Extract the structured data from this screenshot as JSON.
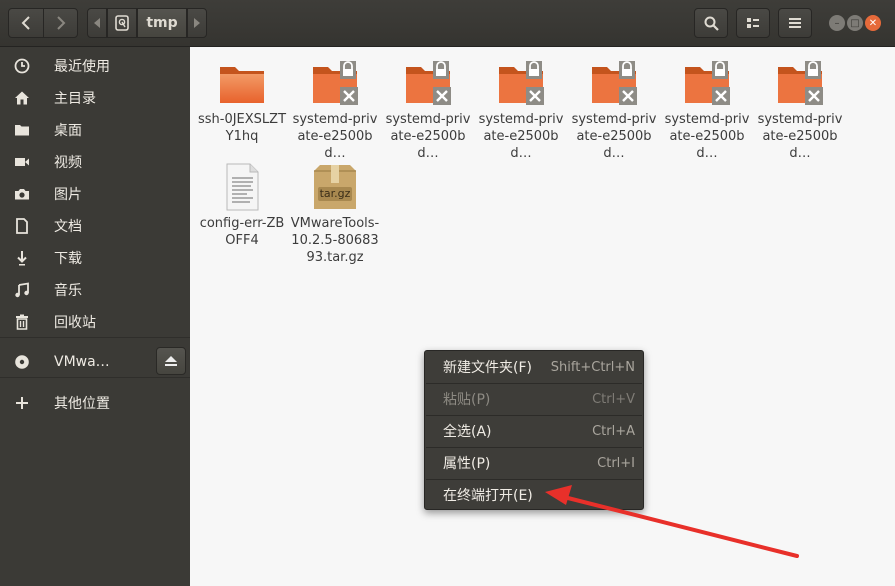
{
  "window": {
    "path": {
      "current": "tmp"
    }
  },
  "sidebar": {
    "items": [
      {
        "label": "最近使用",
        "icon": "clock-icon"
      },
      {
        "label": "主目录",
        "icon": "home-icon"
      },
      {
        "label": "桌面",
        "icon": "folder-icon"
      },
      {
        "label": "视频",
        "icon": "video-icon"
      },
      {
        "label": "图片",
        "icon": "camera-icon"
      },
      {
        "label": "文档",
        "icon": "document-icon"
      },
      {
        "label": "下载",
        "icon": "download-icon"
      },
      {
        "label": "音乐",
        "icon": "music-icon"
      },
      {
        "label": "回收站",
        "icon": "trash-icon"
      },
      {
        "label": "VMwa…",
        "icon": "disc-icon"
      },
      {
        "label": "其他位置",
        "icon": "plus-icon"
      }
    ]
  },
  "files": [
    {
      "name": "ssh-0JEXSLZTY1hq",
      "type": "folder"
    },
    {
      "name": "systemd-private-e2500bd…",
      "type": "folder-locked"
    },
    {
      "name": "systemd-private-e2500bd…",
      "type": "folder-locked"
    },
    {
      "name": "systemd-private-e2500bd…",
      "type": "folder-locked"
    },
    {
      "name": "systemd-private-e2500bd…",
      "type": "folder-locked"
    },
    {
      "name": "systemd-private-e2500bd…",
      "type": "folder-locked"
    },
    {
      "name": "systemd-private-e2500bd…",
      "type": "folder-locked"
    },
    {
      "name": "config-err-ZBOFF4",
      "type": "text-file"
    },
    {
      "name": "VMwareTools-10.2.5-8068393.tar.gz",
      "type": "archive",
      "badge": "tar.gz"
    }
  ],
  "context_menu": {
    "items": [
      {
        "label": "新建文件夹(F)",
        "accel": "Shift+Ctrl+N",
        "enabled": true
      },
      {
        "label": "粘贴(P)",
        "accel": "Ctrl+V",
        "enabled": false
      },
      {
        "label": "全选(A)",
        "accel": "Ctrl+A",
        "enabled": true
      },
      {
        "label": "属性(P)",
        "accel": "Ctrl+I",
        "enabled": true
      },
      {
        "label": "在终端打开(E)",
        "accel": "",
        "enabled": true
      }
    ]
  },
  "colors": {
    "accent": "#e95420",
    "annotation_arrow": "#e8302a"
  }
}
